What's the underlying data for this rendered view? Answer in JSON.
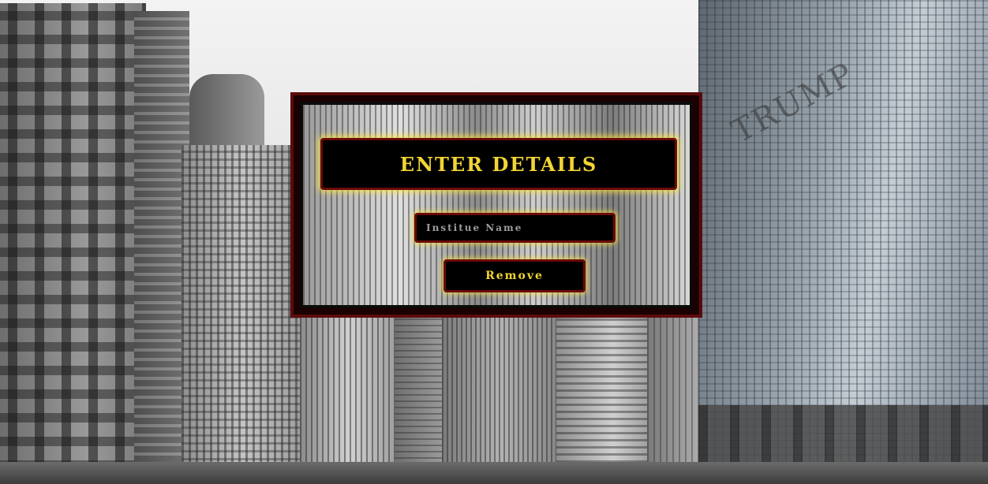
{
  "form": {
    "title": "ENTER DETAILS",
    "institute_input": {
      "value": "",
      "placeholder": "Institue Name"
    },
    "remove_label": "Remove"
  },
  "background": {
    "sign_text": "TRUMP"
  },
  "colors": {
    "accent": "#f2d534",
    "border": "#6a0a0a",
    "panel": "#000000",
    "glow": "#ffe63c"
  }
}
